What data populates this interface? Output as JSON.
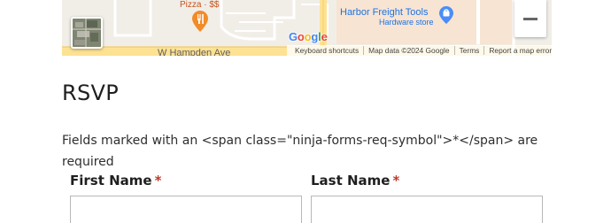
{
  "map": {
    "poi_pizza": "Pizza · $$",
    "poi_harbor_name": "Harbor Freight Tools",
    "poi_harbor_category": "Hardware store",
    "street": "W Hampden Ave",
    "google_logo": [
      "G",
      "o",
      "o",
      "g",
      "l",
      "e"
    ],
    "google_logo_colors": [
      "#4285F4",
      "#EA4335",
      "#FBBC05",
      "#4285F4",
      "#34A853",
      "#EA4335"
    ],
    "attribution": {
      "shortcuts": "Keyboard shortcuts",
      "map_data": "Map data ©2024 Google",
      "terms": "Terms",
      "report": "Report a map error"
    },
    "icons": {
      "food": "food-pin-icon",
      "shop": "shopping-bag-pin-icon",
      "zoom_out": "minus-icon"
    }
  },
  "form": {
    "title": "RSVP",
    "required_note": "Fields marked with an <span class=\"ninja-forms-req-symbol\">*</span> are required",
    "fields": {
      "first_name": {
        "label": "First Name",
        "required_mark": "*",
        "value": ""
      },
      "last_name": {
        "label": "Last Name",
        "required_mark": "*",
        "value": ""
      }
    }
  },
  "colors": {
    "required_star": "#c0392b",
    "map_poi_food": "#c5531b",
    "map_poi_shop": "#1a73e8"
  }
}
